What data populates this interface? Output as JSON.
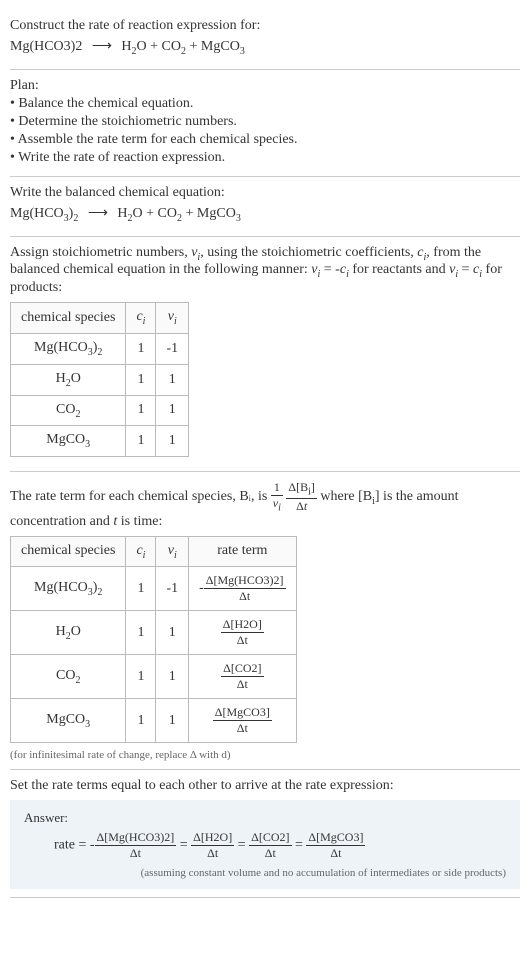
{
  "intro": {
    "title": "Construct the rate of reaction expression for:",
    "equation_left": "Mg(HCO3)2",
    "equation_arrow": "⟶",
    "equation_right": "H₂O + CO₂ + MgCO₃"
  },
  "plan": {
    "heading": "Plan:",
    "items": [
      "• Balance the chemical equation.",
      "• Determine the stoichiometric numbers.",
      "• Assemble the rate term for each chemical species.",
      "• Write the rate of reaction expression."
    ]
  },
  "balanced": {
    "heading": "Write the balanced chemical equation:",
    "equation_left": "Mg(HCO₃)₂",
    "equation_arrow": "⟶",
    "equation_right": "H₂O + CO₂ + MgCO₃"
  },
  "stoich": {
    "text1": "Assign stoichiometric numbers, νᵢ, using the stoichiometric coefficients, cᵢ, from the balanced chemical equation in the following manner: νᵢ = -cᵢ for reactants and νᵢ = cᵢ for products:",
    "headers": [
      "chemical species",
      "cᵢ",
      "νᵢ"
    ],
    "rows": [
      [
        "Mg(HCO₃)₂",
        "1",
        "-1"
      ],
      [
        "H₂O",
        "1",
        "1"
      ],
      [
        "CO₂",
        "1",
        "1"
      ],
      [
        "MgCO₃",
        "1",
        "1"
      ]
    ]
  },
  "rateterm": {
    "text1": "The rate term for each chemical species, Bᵢ, is ",
    "text2": " where [Bᵢ] is the amount concentration and t is time:",
    "frac1_num": "1",
    "frac1_den": "νᵢ",
    "frac2_num": "Δ[Bᵢ]",
    "frac2_den": "Δt",
    "headers": [
      "chemical species",
      "cᵢ",
      "νᵢ",
      "rate term"
    ],
    "rows": [
      {
        "species": "Mg(HCO₃)₂",
        "c": "1",
        "v": "-1",
        "sign": "-",
        "num": "Δ[Mg(HCO3)2]",
        "den": "Δt"
      },
      {
        "species": "H₂O",
        "c": "1",
        "v": "1",
        "sign": "",
        "num": "Δ[H2O]",
        "den": "Δt"
      },
      {
        "species": "CO₂",
        "c": "1",
        "v": "1",
        "sign": "",
        "num": "Δ[CO2]",
        "den": "Δt"
      },
      {
        "species": "MgCO₃",
        "c": "1",
        "v": "1",
        "sign": "",
        "num": "Δ[MgCO3]",
        "den": "Δt"
      }
    ],
    "note": "(for infinitesimal rate of change, replace Δ with d)"
  },
  "final": {
    "heading": "Set the rate terms equal to each other to arrive at the rate expression:",
    "answer_label": "Answer:",
    "rate_prefix": "rate = ",
    "terms": [
      {
        "sign": "-",
        "num": "Δ[Mg(HCO3)2]",
        "den": "Δt"
      },
      {
        "sign": "",
        "num": "Δ[H2O]",
        "den": "Δt"
      },
      {
        "sign": "",
        "num": "Δ[CO2]",
        "den": "Δt"
      },
      {
        "sign": "",
        "num": "Δ[MgCO3]",
        "den": "Δt"
      }
    ],
    "eq": " = ",
    "note": "(assuming constant volume and no accumulation of intermediates or side products)"
  }
}
